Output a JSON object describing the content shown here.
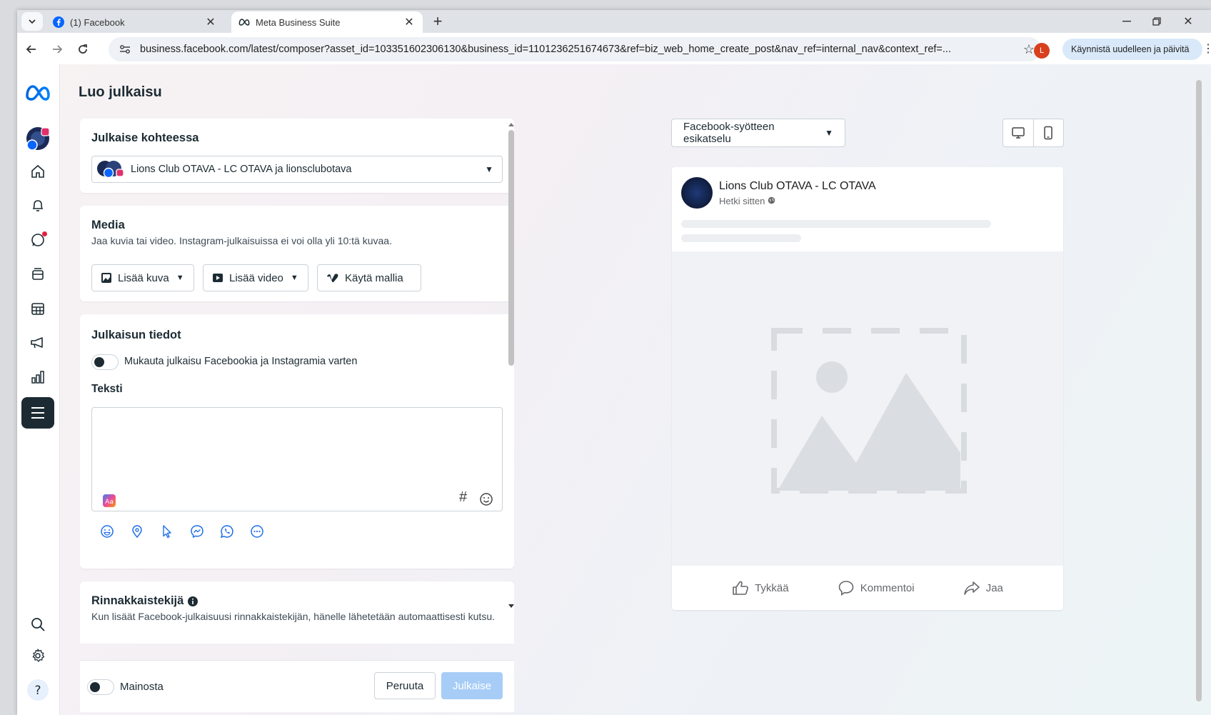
{
  "browser": {
    "tabs": [
      {
        "title": "(1) Facebook",
        "active": false
      },
      {
        "title": "Meta Business Suite",
        "active": true
      }
    ],
    "new_tab_label": "+",
    "url": "business.facebook.com/latest/composer?asset_id=103351602306130&business_id=1101236251674673&ref=biz_web_home_create_post&nav_ref=internal_nav&context_ref=...",
    "profile_initial": "L",
    "update_button_label": "Käynnistä uudelleen ja päivitä"
  },
  "page": {
    "title": "Luo julkaisu"
  },
  "publish_to": {
    "heading": "Julkaise kohteessa",
    "selected_account": "Lions Club OTAVA - LC OTAVA ja lionsclubotava"
  },
  "media": {
    "heading": "Media",
    "description": "Jaa kuvia tai video. Instagram-julkaisuissa ei voi olla yli 10:tä kuvaa.",
    "add_photo_label": "Lisää kuva",
    "add_video_label": "Lisää video",
    "use_template_label": "Käytä mallia"
  },
  "post_details": {
    "heading": "Julkaisun tiedot",
    "customize_toggle_label": "Mukauta julkaisu Facebookia ja Instagramia varten",
    "text_label": "Teksti",
    "text_value": "",
    "hashtag_symbol": "#"
  },
  "collaborator": {
    "heading": "Rinnakkaistekijä",
    "description": "Kun lisäät Facebook-julkaisuusi rinnakkaistekijän, hänelle lähetetään automaattisesti kutsu."
  },
  "footer": {
    "boost_label": "Mainosta",
    "cancel_label": "Peruuta",
    "publish_label": "Julkaise"
  },
  "preview": {
    "mode_label": "Facebook-syötteen esikatselu",
    "page_name": "Lions Club OTAVA - LC OTAVA",
    "time_label": "Hetki sitten",
    "like_label": "Tykkää",
    "comment_label": "Kommentoi",
    "share_label": "Jaa"
  },
  "colors": {
    "accent_blue": "#0866ff",
    "publish_disabled": "#a7cdf7",
    "rail_active": "#1c2b33"
  }
}
